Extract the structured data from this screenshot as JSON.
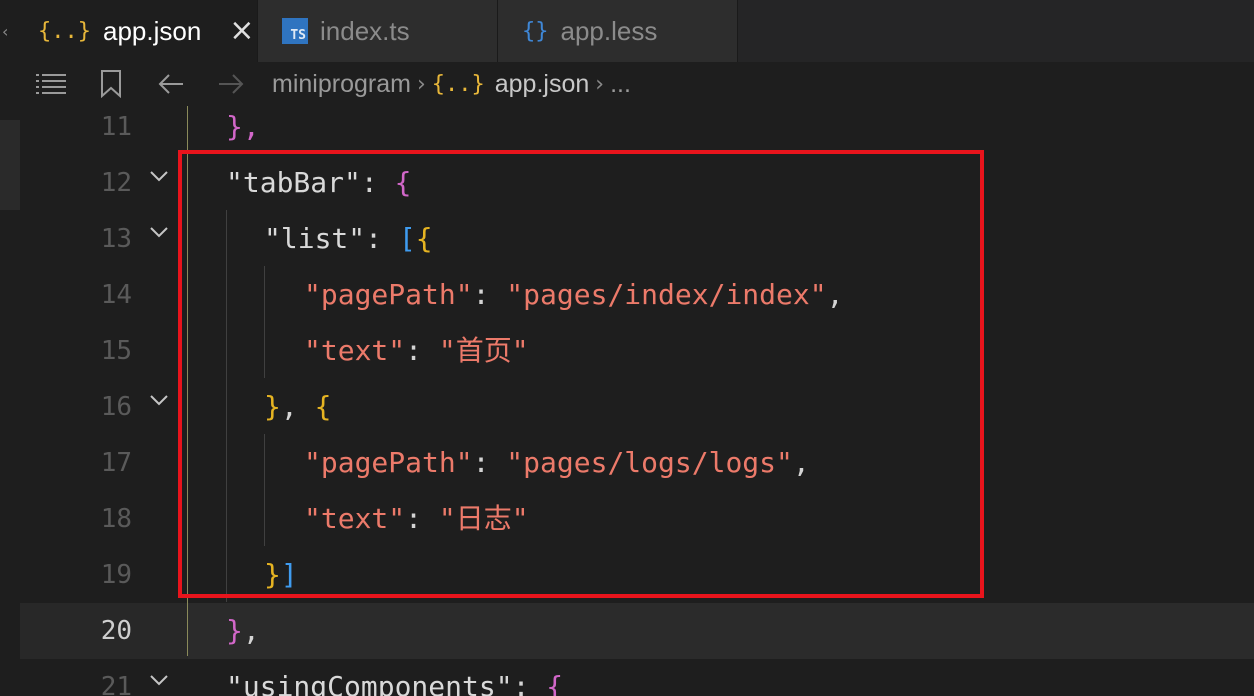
{
  "tabs": [
    {
      "icon": "json-file-icon",
      "icon_text": "{..}",
      "label": "app.json",
      "active": true
    },
    {
      "icon": "typescript-file-icon",
      "icon_text": "TS",
      "label": "index.ts",
      "active": false
    },
    {
      "icon": "less-file-icon",
      "icon_text": "{}",
      "label": "app.less",
      "active": false
    }
  ],
  "tab_close_symbol": "×",
  "breadcrumb": {
    "folder": "miniprogram",
    "file_icon_text": "{..}",
    "file": "app.json",
    "ellipsis": "...",
    "separator": "›"
  },
  "line_numbers": [
    "11",
    "12",
    "13",
    "14",
    "15",
    "16",
    "17",
    "18",
    "19",
    "20",
    "21"
  ],
  "current_line": "20",
  "code": {
    "l11_close": "},",
    "l12_key": "\"tabBar\"",
    "l12_colon": ": ",
    "l12_brace": "{",
    "l13_key": "\"list\"",
    "l13_colon": ": ",
    "l13_bracket": "[",
    "l13_brace": "{",
    "l14_key": "\"pagePath\"",
    "l14_colon": ": ",
    "l14_value": "\"pages/index/index\"",
    "l14_comma": ",",
    "l15_key": "\"text\"",
    "l15_colon": ": ",
    "l15_value": "\"首页\"",
    "l16_close": "}",
    "l16_comma": ", ",
    "l16_open": "{",
    "l17_key": "\"pagePath\"",
    "l17_colon": ": ",
    "l17_value": "\"pages/logs/logs\"",
    "l17_comma": ",",
    "l18_key": "\"text\"",
    "l18_colon": ": ",
    "l18_value": "\"日志\"",
    "l19_brace": "}",
    "l19_bracket": "]",
    "l20_brace": "}",
    "l20_comma": ",",
    "l21_key": "\"usingComponents\"",
    "l21_colon": ": ",
    "l21_brace": "{"
  },
  "colors": {
    "string": "#ec7a6a",
    "brace_level1": "#e6b422",
    "brace_level2": "#d267c9",
    "brace_level3": "#3f9cf0",
    "highlight_box": "#e8141c"
  }
}
